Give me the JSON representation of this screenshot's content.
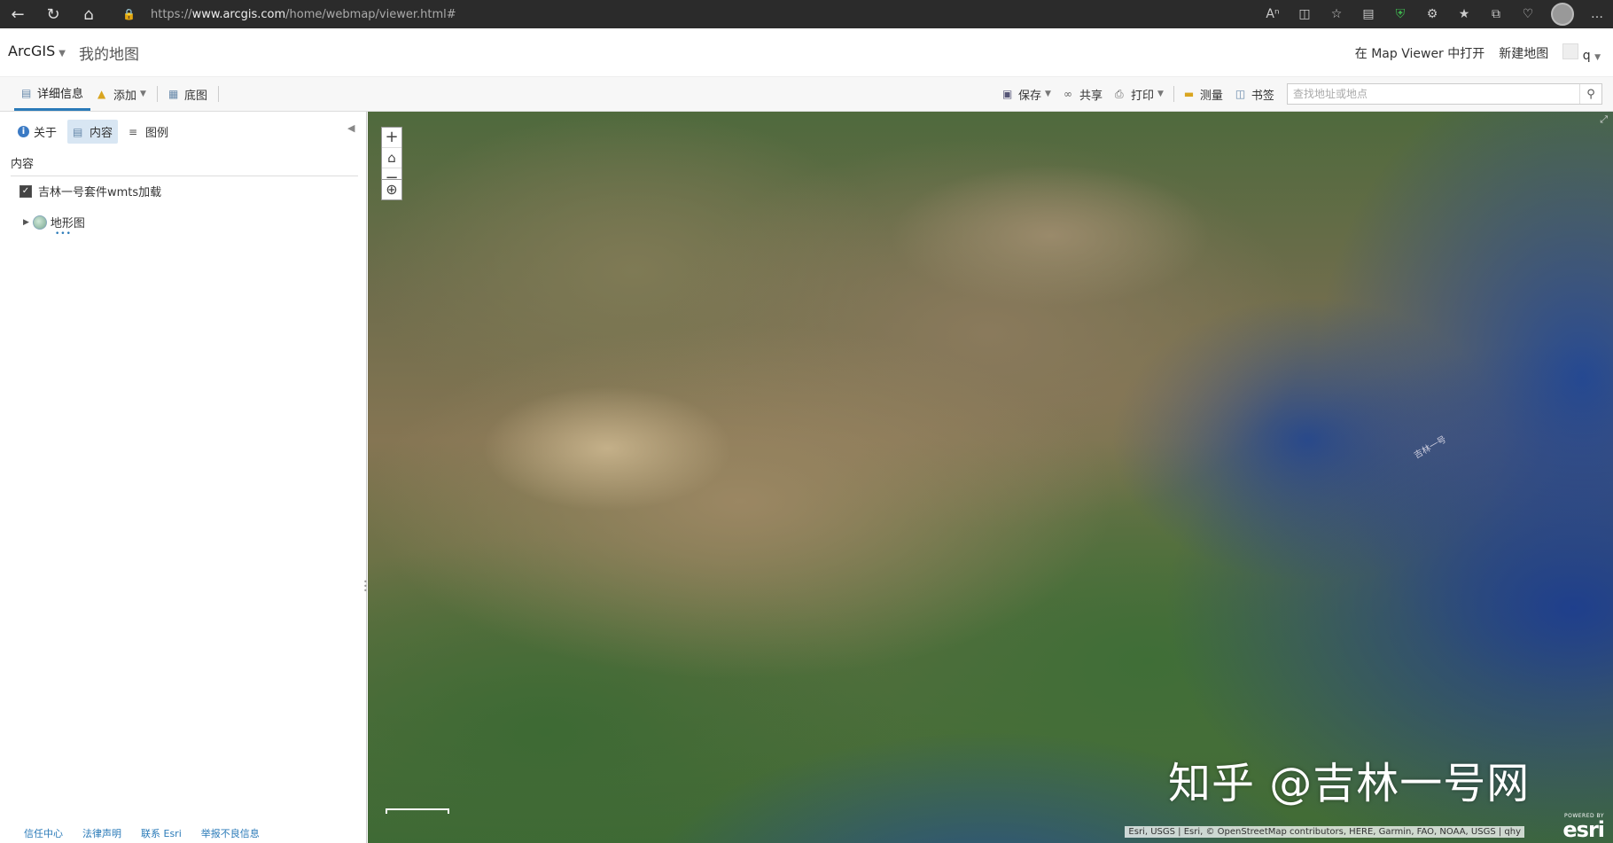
{
  "browser": {
    "url_prefix": "https://",
    "url_domain": "www.arcgis.com",
    "url_path": "/home/webmap/viewer.html#",
    "icons": [
      "read-aloud-icon",
      "split-screen-icon",
      "favorite-star-icon",
      "browser-essentials-icon",
      "shield-icon",
      "extensions-icon",
      "favorites-icon",
      "collections-icon",
      "health-icon",
      "profile-avatar",
      "more-icon"
    ]
  },
  "header": {
    "brand": "ArcGIS",
    "title": "我的地图",
    "open_in_mapviewer": "在 Map Viewer 中打开",
    "new_map": "新建地图",
    "user": "q"
  },
  "toolbar": {
    "details": "详细信息",
    "add": "添加",
    "basemap": "底图",
    "save": "保存",
    "share": "共享",
    "print": "打印",
    "measure": "测量",
    "bookmarks": "书签",
    "search_placeholder": "查找地址或地点"
  },
  "panel": {
    "tabs": {
      "about": "关于",
      "content": "内容",
      "legend": "图例"
    },
    "content_header": "内容",
    "layers": [
      {
        "name": "吉林一号套件wmts加载",
        "checked": true
      },
      {
        "name": "地形图"
      }
    ],
    "more": "•••",
    "footer": [
      "信任中心",
      "法律声明",
      "联系 Esri",
      "举报不良信息"
    ]
  },
  "map": {
    "map_label": "吉林一号",
    "watermark": "知乎 @吉林一号网",
    "attribution": "Esri, USGS | Esri, © OpenStreetMap contributors, HERE, Garmin, FAO, NOAA, USGS | qhy",
    "esri_powered": "POWERED BY",
    "esri_word": "esri"
  }
}
